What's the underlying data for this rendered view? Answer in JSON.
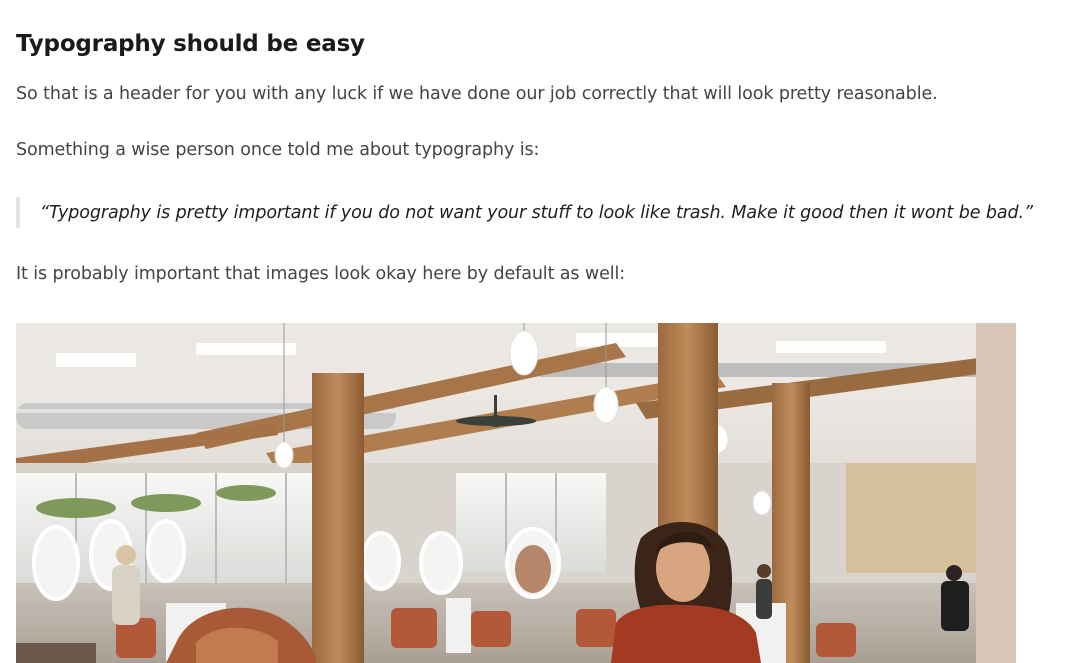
{
  "article": {
    "heading": "Typography should be easy",
    "paragraph_1": "So that is a header for you with any luck if we have done our job correctly that will look pretty reasonable.",
    "paragraph_2": "Something a wise person once told me about typography is:",
    "quote": "“Typography is pretty important if you do not want your stuff to look like trash. Make it good then it wont be bad.”",
    "paragraph_3": "It is probably important that images look okay here by default as well:"
  },
  "image": {
    "subject": "salon-interior-photo"
  },
  "colors": {
    "heading": "#1a1a1a",
    "body_text": "#444444",
    "quote_text": "#1f1f1f",
    "quote_border": "#e4e4e4",
    "background": "#ffffff"
  }
}
